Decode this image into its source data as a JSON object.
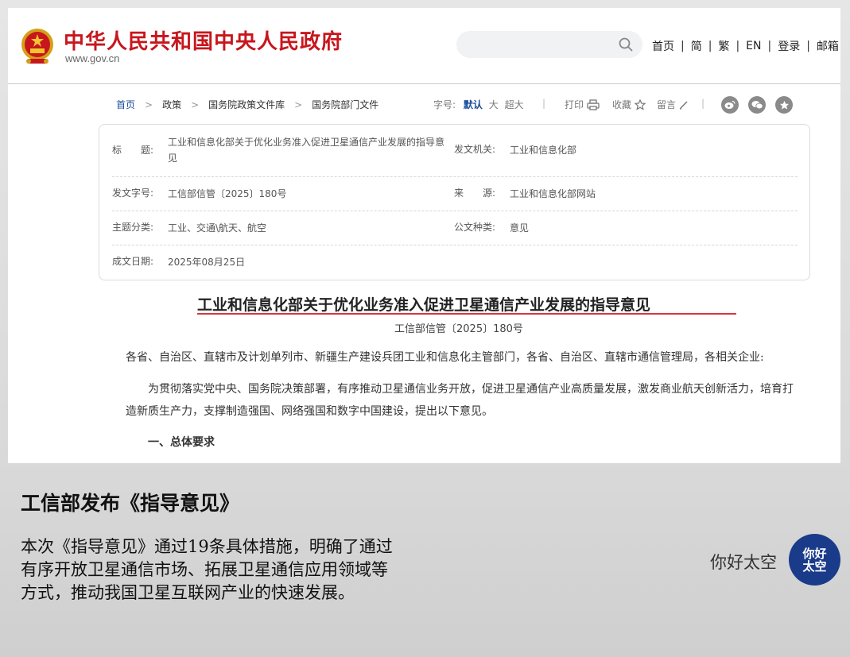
{
  "header": {
    "site_title": "中华人民共和国中央人民政府",
    "site_domain": "www.gov.cn",
    "search_placeholder": "",
    "nav": [
      "首页",
      "简",
      "繁",
      "EN",
      "登录",
      "邮箱"
    ]
  },
  "breadcrumb": [
    "首页",
    "政策",
    "国务院政策文件库",
    "国务院部门文件"
  ],
  "tools": {
    "font_size_label": "字号:",
    "font_sizes": [
      "默认",
      "大",
      "超大"
    ],
    "print": "打印",
    "favorite": "收藏",
    "comment": "留言"
  },
  "meta": {
    "title_label": "标　　题:",
    "title_value": "工业和信息化部关于优化业务准入促进卫星通信产业发展的指导意见",
    "issuer_label": "发文机关:",
    "issuer_value": "工业和信息化部",
    "doc_no_label": "发文字号:",
    "doc_no_value": "工信部信管〔2025〕180号",
    "source_label": "来　　源:",
    "source_value": "工业和信息化部网站",
    "topic_label": "主题分类:",
    "topic_value": "工业、交通\\航天、航空",
    "type_label": "公文种类:",
    "type_value": "意见",
    "date_label": "成文日期:",
    "date_value": "2025年08月25日"
  },
  "document": {
    "title": "工业和信息化部关于优化业务准入促进卫星通信产业发展的指导意见",
    "number": "工信部信管〔2025〕180号",
    "addressee": "各省、自治区、直辖市及计划单列市、新疆生产建设兵团工业和信息化主管部门，各省、自治区、直辖市通信管理局，各相关企业:",
    "para1": "为贯彻落实党中央、国务院决策部署，有序推动卫星通信业务开放，促进卫星通信产业高质量发展，激发商业航天创新活力，培育打造新质生产力，支撑制造强国、网络强国和数字中国建设，提出以下意见。",
    "section1": "一、总体要求"
  },
  "caption": {
    "title": "工信部发布《指导意见》",
    "body": "本次《指导意见》通过19条具体措施，明确了通过有序开放卫星通信市场、拓展卫星通信应用领域等方式，推动我国卫星互联网产业的快速发展。"
  },
  "brand": {
    "text": "你好太空",
    "logo_line1": "你好",
    "logo_line2": "太空"
  },
  "colors": {
    "gov_red": "#c8161d",
    "link_blue": "#1a4d9c",
    "underline_red": "#d9363e",
    "brand_blue": "#1a3a8a"
  }
}
